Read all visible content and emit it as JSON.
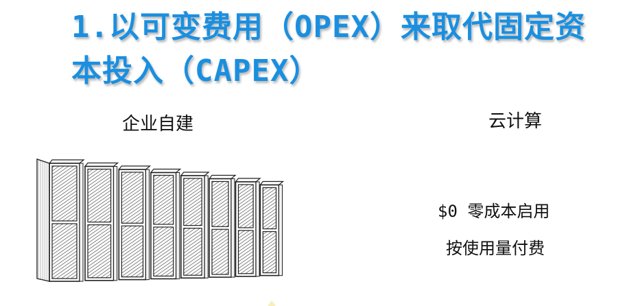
{
  "slide": {
    "title_line1": "1.以可变费用（OPEX）来取代固定资",
    "title_line2": "本投入（CAPEX）",
    "title_color": "#1a8fe0"
  },
  "columns": {
    "left_label": "企业自建",
    "right_label": "云计算"
  },
  "cloud_features": [
    "$0 零成本启用",
    "按使用量付费"
  ],
  "illustration": {
    "icon": "server-rack-icon",
    "rack_count": 8
  }
}
